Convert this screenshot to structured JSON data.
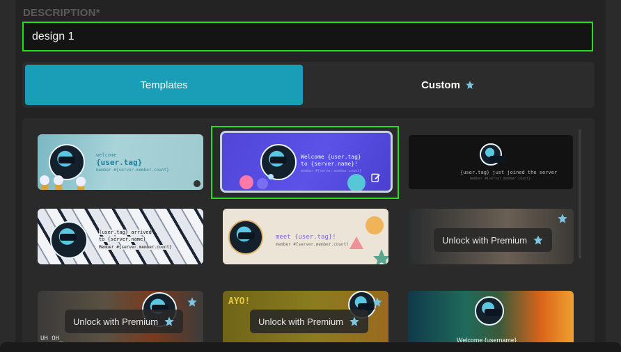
{
  "description": {
    "label": "DESCRIPTION*",
    "value": "design 1"
  },
  "tabs": {
    "templates": "Templates",
    "custom": "Custom"
  },
  "cards": {
    "c1": {
      "line1": "welcome",
      "line2": "{user.tag}",
      "line3": "member #{server.member.count}"
    },
    "c2": {
      "line1": "Welcome {user.tag}",
      "line2": "to {server.name}!",
      "line3": "member #{server.member.count}"
    },
    "c3": {
      "line1": "{user.tag} just joined the server",
      "line2": "member #{server.member.count}"
    },
    "c4": {
      "line1": "{user.tag} arrived",
      "line2": "to {server.name}",
      "line3": "Member #{server.member.count}"
    },
    "c5": {
      "line1": "meet {user.tag}!",
      "line2": "member #{server.member.count}"
    },
    "c6": {
      "premium": "Unlock with Premium"
    },
    "c7": {
      "premium": "Unlock with Premium",
      "caption": "UH OH_"
    },
    "c8": {
      "premium": "Unlock with Premium",
      "caption": "AYO!"
    },
    "c9": {
      "line1": "Welcome {username}"
    }
  },
  "colors": {
    "accent": "#1a9eb8",
    "selection": "#21e11c",
    "premium_star": "#7cc4e0"
  },
  "icons": {
    "star": "star-icon",
    "edit": "edit-icon"
  }
}
